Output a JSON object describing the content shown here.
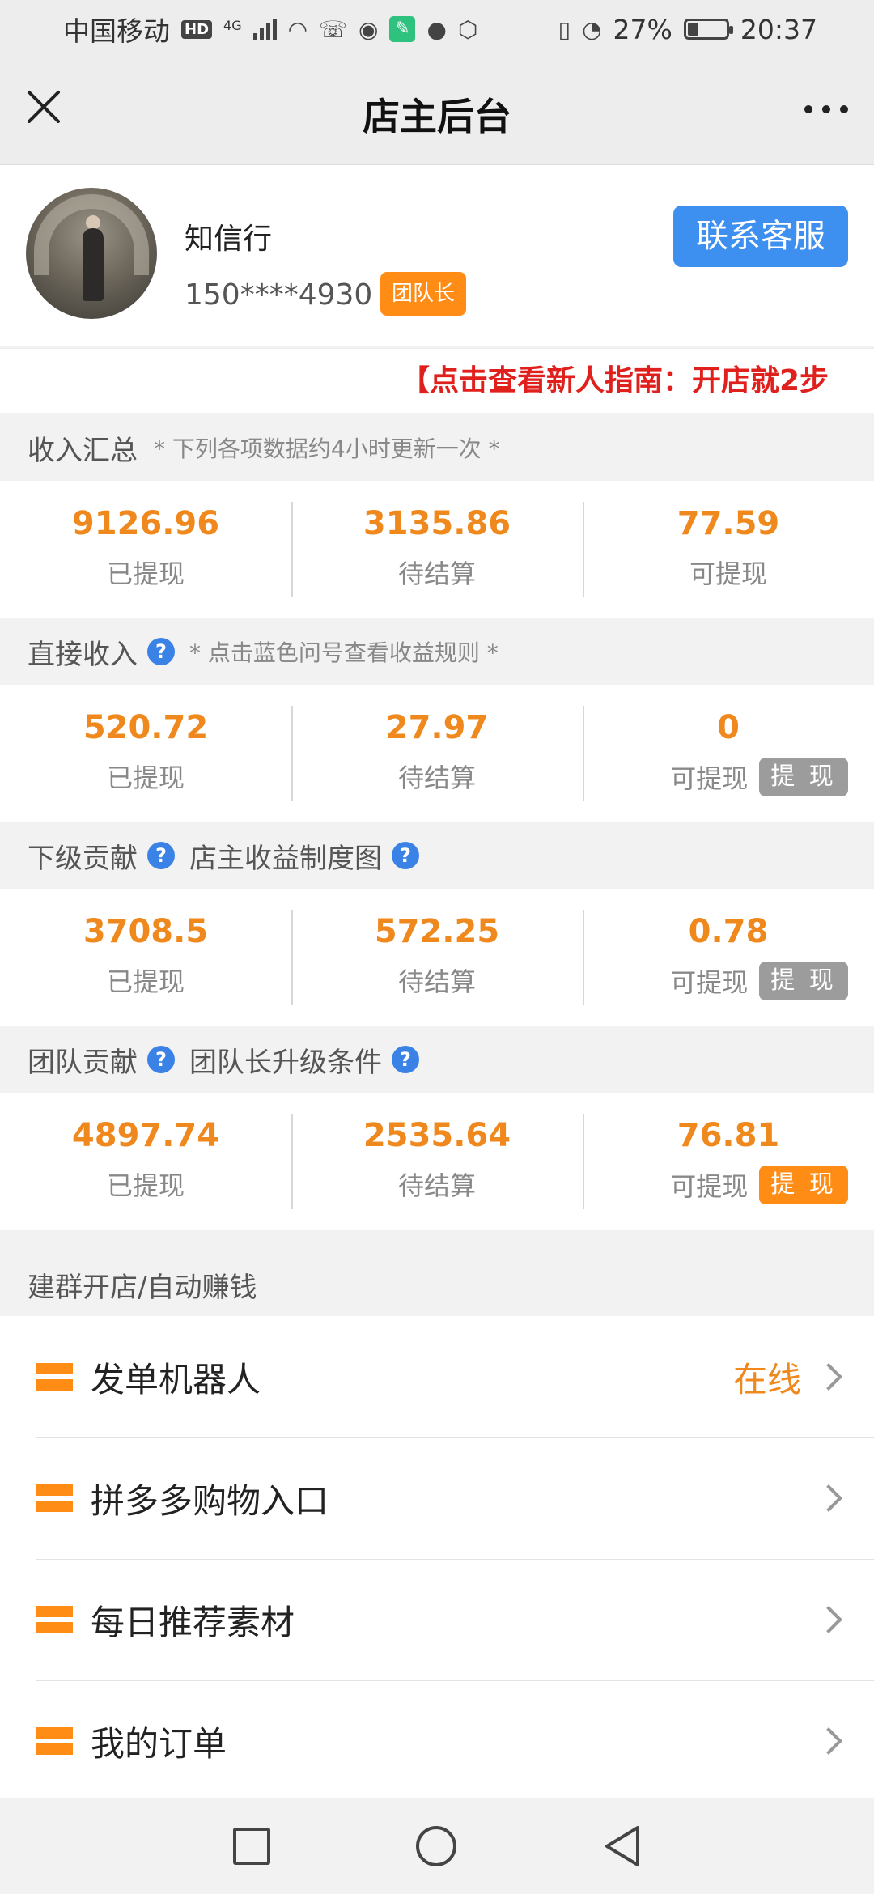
{
  "status_bar": {
    "carrier": "中国移动",
    "hd": "HD",
    "network": "4G",
    "battery_percent": "27%",
    "battery_level": 0.27,
    "time": "20:37"
  },
  "nav": {
    "title": "店主后台"
  },
  "profile": {
    "name": "知信行",
    "phone": "150****4930",
    "role": "团队长",
    "contact_label": "联系客服"
  },
  "guide": {
    "text": "【点击查看新人指南：开店就2步"
  },
  "sections": {
    "income_summary": {
      "title": "收入汇总",
      "note": "* 下列各项数据约4小时更新一次 *",
      "withdrawn": "9126.96",
      "pending": "3135.86",
      "available": "77.59"
    },
    "direct_income": {
      "title": "直接收入",
      "note": "* 点击蓝色问号查看收益规则 *",
      "withdrawn": "520.72",
      "pending": "27.97",
      "available": "0"
    },
    "sub_contribution": {
      "title": "下级贡献",
      "link": "店主收益制度图",
      "withdrawn": "3708.5",
      "pending": "572.25",
      "available": "0.78"
    },
    "team_contribution": {
      "title": "团队贡献",
      "link": "团队长升级条件",
      "withdrawn": "4897.74",
      "pending": "2535.64",
      "available": "76.81"
    }
  },
  "labels": {
    "withdrawn": "已提现",
    "pending": "待结算",
    "available": "可提现",
    "withdraw_btn": "提 现",
    "qmark": "?"
  },
  "menu": {
    "header": "建群开店/自动赚钱",
    "items": [
      {
        "label": "发单机器人",
        "status": "在线"
      },
      {
        "label": "拼多多购物入口"
      },
      {
        "label": "每日推荐素材"
      },
      {
        "label": "我的订单"
      }
    ]
  },
  "colors": {
    "accent_orange": "#f0891d",
    "badge_orange": "#ff8c14",
    "blue": "#3d8ff0",
    "red": "#e0201c"
  }
}
